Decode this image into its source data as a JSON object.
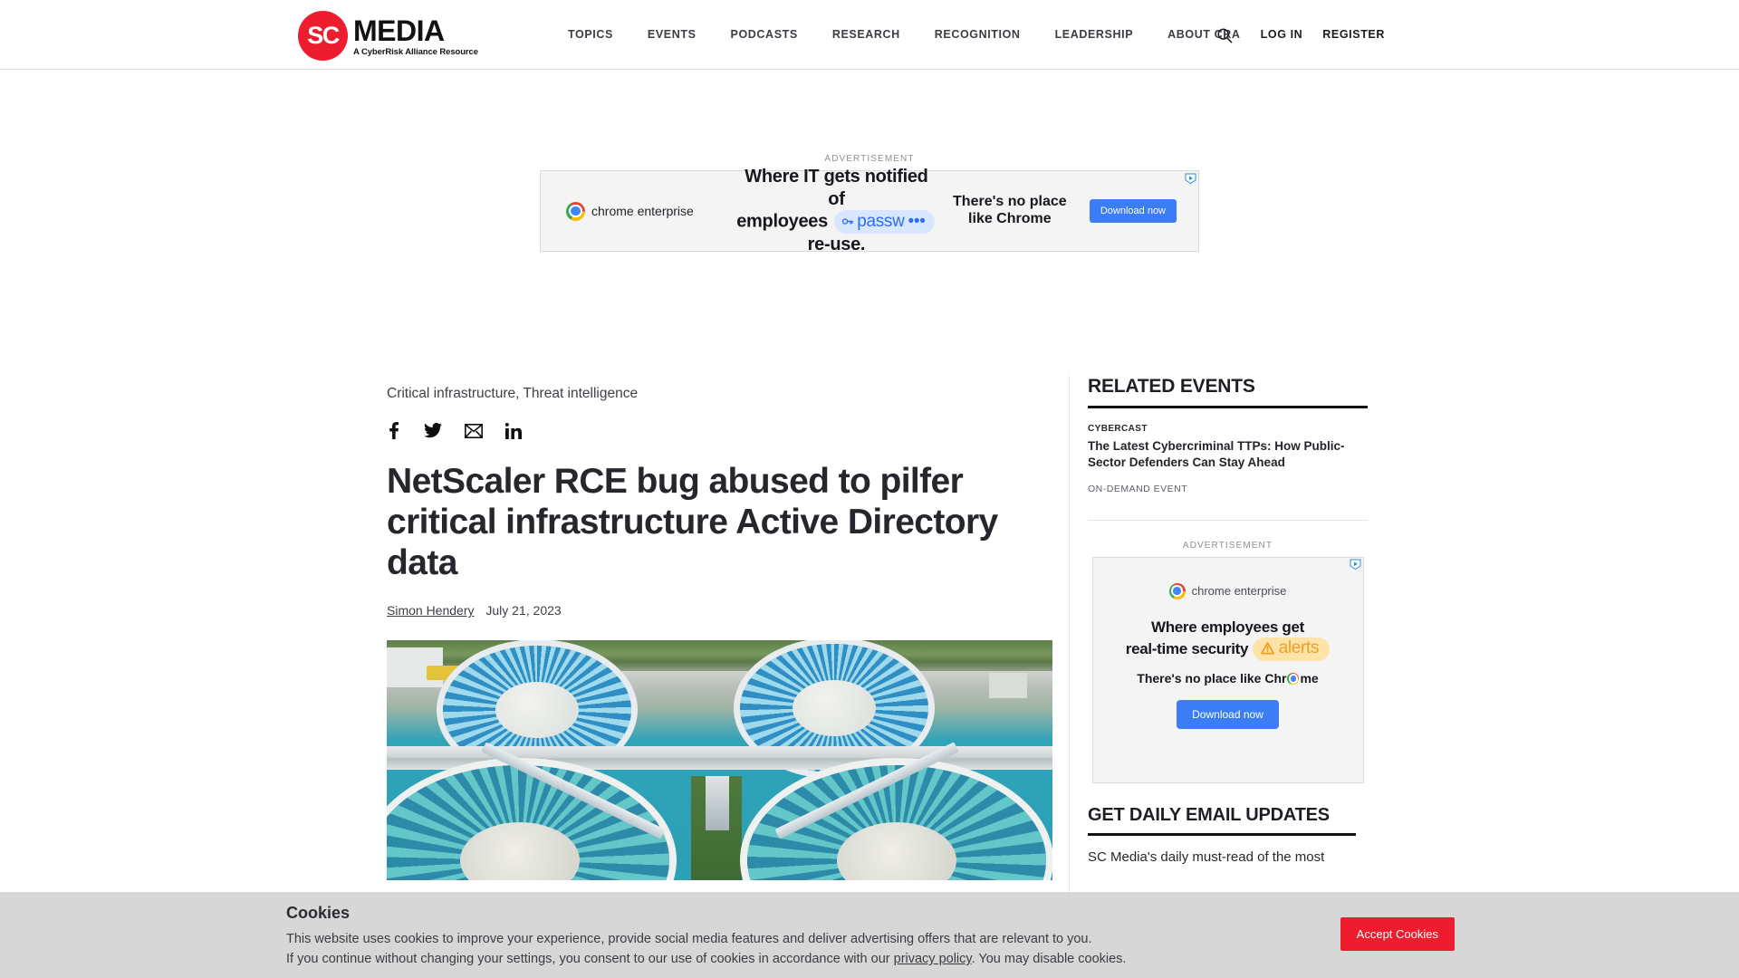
{
  "header": {
    "logo": {
      "mark": "SC",
      "word": "MEDIA",
      "tagline": "A CyberRisk Alliance Resource"
    },
    "nav": [
      {
        "label": "TOPICS"
      },
      {
        "label": "EVENTS"
      },
      {
        "label": "PODCASTS"
      },
      {
        "label": "RESEARCH"
      },
      {
        "label": "RECOGNITION"
      },
      {
        "label": "LEADERSHIP"
      },
      {
        "label": "ABOUT CRA"
      }
    ],
    "login_label": "LOG IN",
    "register_label": "REGISTER",
    "search_icon": "search-icon"
  },
  "top_ad": {
    "label": "ADVERTISEMENT",
    "brand": "chrome enterprise",
    "headline_1": "Where IT gets notified of",
    "headline_2_pre": "employees",
    "headline_pill": "passw",
    "headline_pill_dots": "•••",
    "headline_2_post": "re-use.",
    "sub_line_1": "There's no place",
    "sub_line_2": "like Chrome",
    "cta": "Download now",
    "adchoices_icon": "adchoices-icon"
  },
  "article": {
    "categories": "Critical infrastructure, Threat intelligence",
    "share": [
      {
        "name": "facebook-icon"
      },
      {
        "name": "twitter-icon"
      },
      {
        "name": "email-icon"
      },
      {
        "name": "linkedin-icon"
      }
    ],
    "headline": "NetScaler RCE bug abused to pilfer critical infrastructure Active Directory data",
    "author": "Simon Hendery",
    "date": "July 21, 2023",
    "hero_alt": "Aerial view of a water treatment plant with circular clarifier tanks"
  },
  "sidebar": {
    "related_events": {
      "heading": "RELATED EVENTS",
      "items": [
        {
          "type": "CYBERCAST",
          "title": "The Latest Cybercriminal TTPs: How Public-Sector Defenders Can Stay Ahead",
          "meta": "ON-DEMAND EVENT"
        }
      ]
    },
    "ad": {
      "label": "ADVERTISEMENT",
      "brand": "chrome enterprise",
      "headline_1": "Where employees get",
      "headline_2": "real-time security",
      "headline_pill": "alerts",
      "sub_pre": "There's no place like Chr",
      "sub_post": "me",
      "cta": "Download now",
      "adchoices_icon": "adchoices-icon"
    },
    "email": {
      "heading": "GET DAILY EMAIL UPDATES",
      "copy": "SC Media's daily must-read of the most"
    }
  },
  "cookies": {
    "title": "Cookies",
    "line1": "This website uses cookies to improve your experience, provide social media features and deliver advertising offers that are relevant to you.",
    "line2_pre": "If you continue without changing your settings, you consent to our use of cookies in accordance with our ",
    "privacy_link": "privacy policy",
    "line2_post": ". You may disable cookies.",
    "accept_label": "Accept Cookies"
  },
  "colors": {
    "brand_red": "#ed1c2e",
    "ad_blue": "#3b7df4",
    "cookie_bg": "#d7d7d7"
  }
}
